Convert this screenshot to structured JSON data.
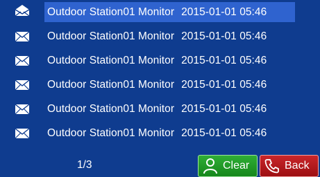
{
  "messages": [
    {
      "title": "Outdoor Station01 Monitor",
      "time": "2015-01-01 05:46",
      "status": "read",
      "icon": "envelope-open-icon",
      "selected": true
    },
    {
      "title": "Outdoor Station01 Monitor",
      "time": "2015-01-01 05:46",
      "status": "unread",
      "icon": "envelope-icon",
      "selected": false
    },
    {
      "title": "Outdoor Station01 Monitor",
      "time": "2015-01-01 05:46",
      "status": "unread",
      "icon": "envelope-icon",
      "selected": false
    },
    {
      "title": "Outdoor Station01 Monitor",
      "time": "2015-01-01 05:46",
      "status": "unread",
      "icon": "envelope-icon",
      "selected": false
    },
    {
      "title": "Outdoor Station01 Monitor",
      "time": "2015-01-01 05:46",
      "status": "unread",
      "icon": "envelope-icon",
      "selected": false
    },
    {
      "title": "Outdoor Station01 Monitor",
      "time": "2015-01-01 05:46",
      "status": "unread",
      "icon": "envelope-icon",
      "selected": false
    }
  ],
  "pagination": {
    "label": "1/3"
  },
  "buttons": {
    "clear": {
      "label": "Clear",
      "icon": "person-icon",
      "color": "#1e9a25"
    },
    "back": {
      "label": "Back",
      "icon": "phone-icon",
      "color": "#b51a1e"
    }
  },
  "colors": {
    "background": "#0f3c8f",
    "selection": "#2f63cf",
    "text": "#ffffff"
  }
}
